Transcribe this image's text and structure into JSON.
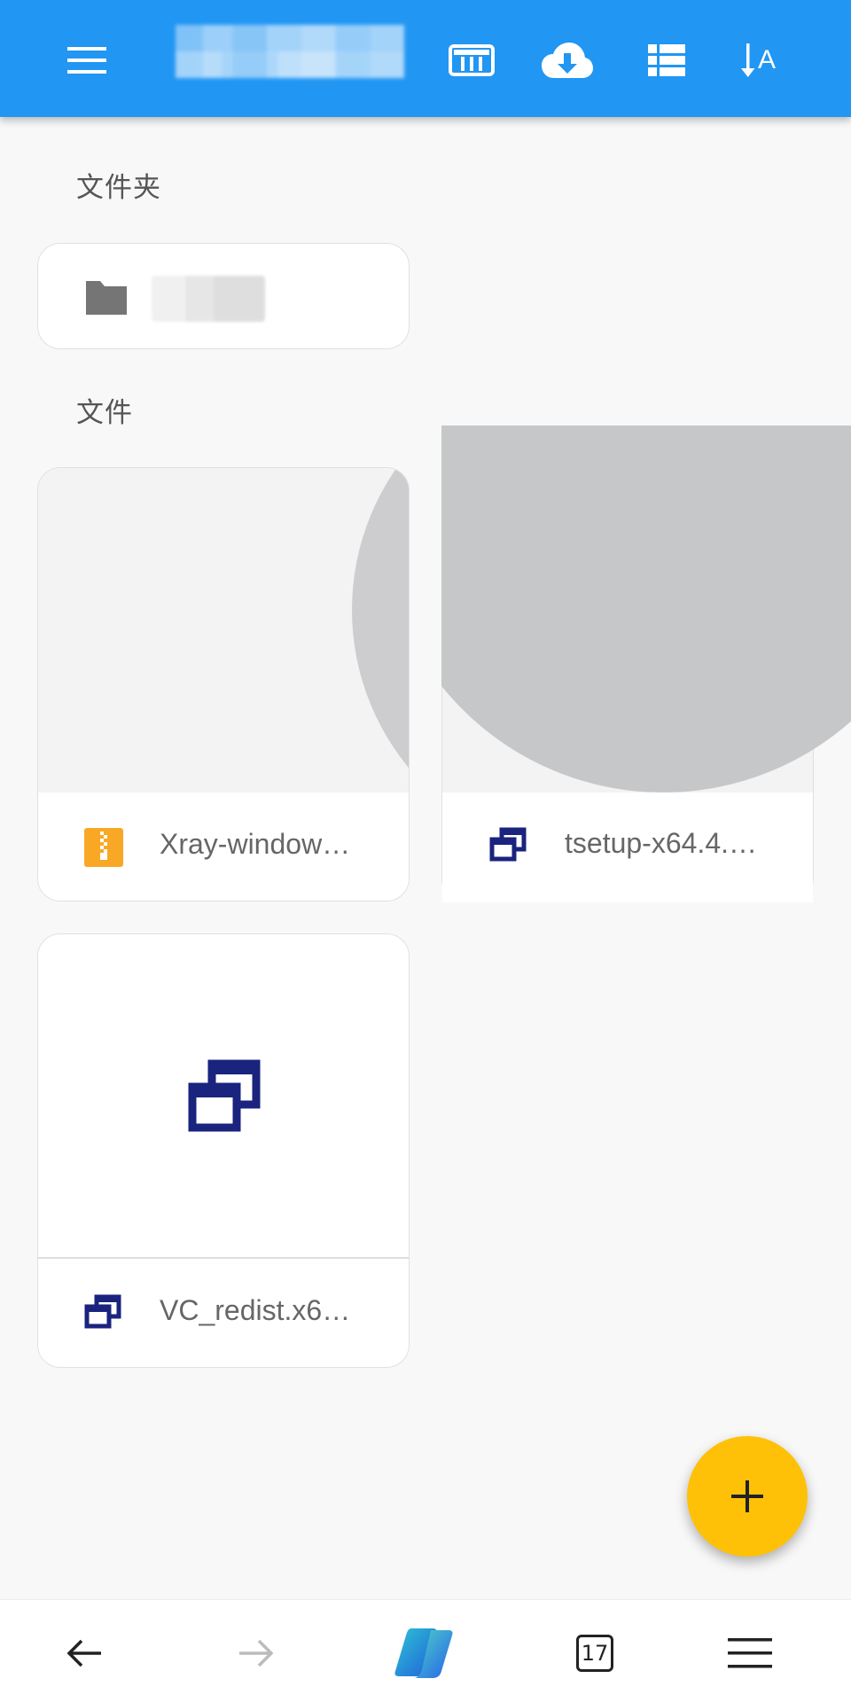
{
  "app_bar": {
    "title": "",
    "icons": [
      "menu-icon",
      "view-icon",
      "cloud-download-icon",
      "list-view-icon",
      "sort-icon"
    ]
  },
  "sections": {
    "folders_title": "文件夹",
    "files_title": "文件"
  },
  "folders": [
    {
      "name": "",
      "icon": "folder-icon"
    }
  ],
  "files": [
    {
      "name": "Xray-window…",
      "icon": "zip-archive-icon"
    },
    {
      "name": "tsetup-x64.4.…",
      "icon": "executable-icon"
    },
    {
      "name": "VC_redist.x6…",
      "icon": "executable-icon"
    }
  ],
  "fab": {
    "icon": "plus-icon"
  },
  "bottom_nav": {
    "tab_count": "17",
    "icons": [
      "back-arrow-icon",
      "forward-arrow-icon",
      "copilot-icon",
      "tabs-icon",
      "menu-icon"
    ]
  },
  "colors": {
    "app_bar": "#2196f3",
    "fab": "#ffc107",
    "exe_icon": "#1a237e",
    "zip_icon": "#f9a825"
  }
}
